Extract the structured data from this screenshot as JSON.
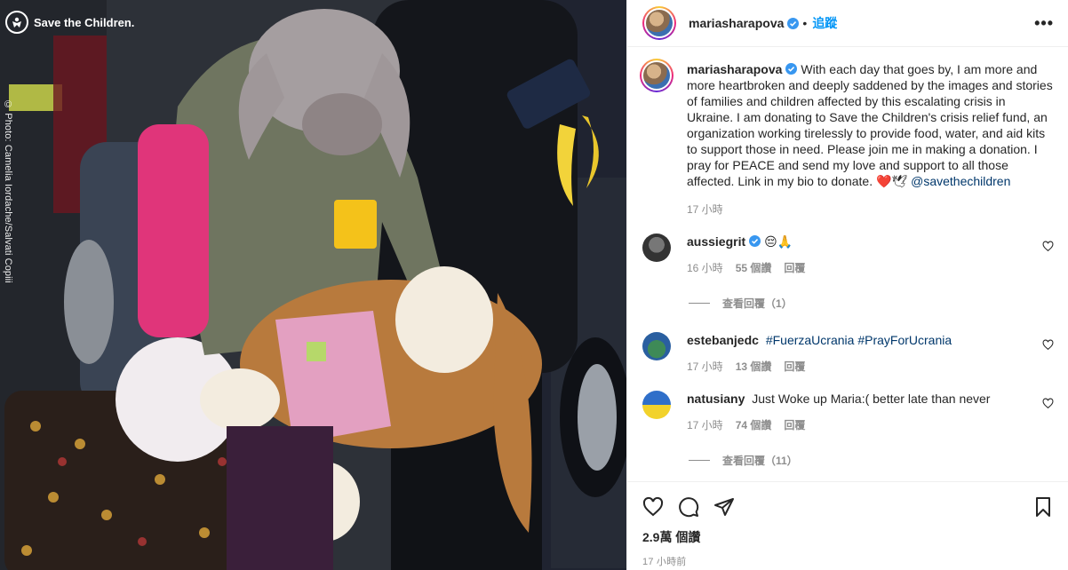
{
  "photo": {
    "badge_text": "Save the Children.",
    "credit": "© Photo: Camelia Iordache/Salvati Copiii"
  },
  "header": {
    "username": "mariasharapova",
    "dot": "•",
    "follow_label": "追蹤",
    "more_label": "•••"
  },
  "caption": {
    "username": "mariasharapova",
    "text": "With each day that goes by, I am more and more heartbroken and deeply saddened by the images and stories of families and children affected by this escalating crisis in Ukraine. I am donating to Save the Children's crisis relief fund, an organization working tirelessly to provide food, water, and aid kits to support those in need. Please join me in making a donation. I pray for PEACE and send my love and support to all those affected. Link in my bio to donate.",
    "emoji": "❤️🕊",
    "mention": "@savethechildren",
    "time": "17 小時"
  },
  "comments": [
    {
      "username": "aussiegrit",
      "verified": true,
      "text": "😔🙏",
      "time": "16 小時",
      "likes": "55 個讚",
      "reply": "回覆",
      "view_replies": "查看回覆（1）"
    },
    {
      "username": "estebanjedc",
      "verified": false,
      "hashtags": [
        "#FuerzaUcrania",
        "#PrayForUcrania"
      ],
      "time": "17 小時",
      "likes": "13 個讚",
      "reply": "回覆"
    },
    {
      "username": "natusiany",
      "verified": false,
      "text": "Just Woke up Maria:( better late than never",
      "time": "17 小時",
      "likes": "74 個讚",
      "reply": "回覆",
      "view_replies": "查看回覆（11）"
    }
  ],
  "footer": {
    "likes": "2.9萬 個讚",
    "time": "17 小時前"
  },
  "colors": {
    "accent": "#0095f6",
    "link": "#00376b",
    "muted": "#8e8e8e",
    "verified": "#3897f0",
    "heart_red": "#c8102e"
  }
}
